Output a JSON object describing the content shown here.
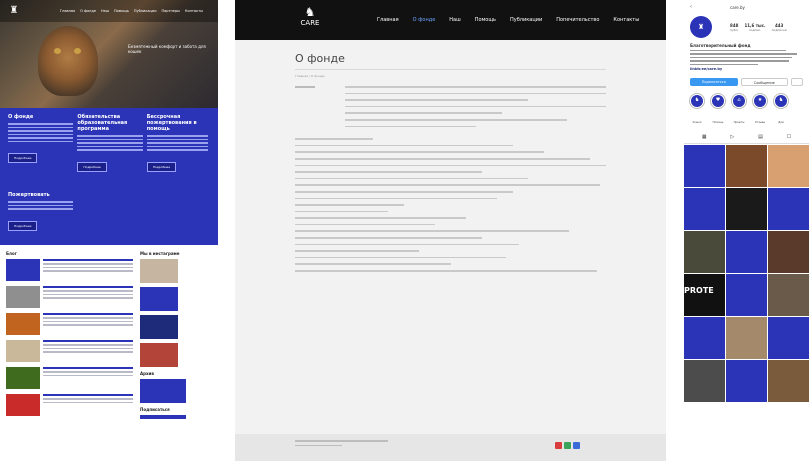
{
  "left": {
    "menu": [
      "Главная",
      "О фонде",
      "Наш",
      "Помощь",
      "Публикации",
      "Партнеры",
      "Контакты"
    ],
    "hero_text": "Безмятежный комфорт и забота для кошек",
    "blue_blocks": [
      {
        "title": "О фонде",
        "button": "Подробнее"
      },
      {
        "title": "Обязательства образовательная программа",
        "button": "Подробнее"
      },
      {
        "title": "Бессрочная пожертвования в помощь",
        "button": "Подробнее"
      },
      {
        "title": "Пожертвовать",
        "button": "Подробнее"
      }
    ],
    "news_heading": "Блог",
    "sidebar_heading": "Мы в инстаграме",
    "sidebar_heading2": "Архив",
    "sidebar_heading3": "Подписаться"
  },
  "mid": {
    "logo": "CARE",
    "menu": [
      "Главная",
      "О фонде",
      "Наш",
      "Помощь",
      "Публикации",
      "Попечительство",
      "Контакты"
    ],
    "active_index": 1,
    "title": "О фонде",
    "breadcrumb": "Главная / О фонде"
  },
  "right": {
    "back_icon": "chevron-left-icon",
    "username": "care.by",
    "stats": [
      {
        "value": "848",
        "label": "публ."
      },
      {
        "value": "11,6 тыс.",
        "label": "подпис."
      },
      {
        "value": "443",
        "label": "подписки"
      }
    ],
    "name": "Благотворительный фонд",
    "link": "linktr.ee/care.by",
    "buttons": [
      "Подписаться",
      "Сообщение"
    ],
    "highlights": [
      "Кошки",
      "Помощь",
      "Приюты",
      "Отзывы",
      "Дом"
    ],
    "grid_label": "PROTE"
  },
  "colors": {
    "brand_blue": "#2b33b6",
    "dark": "#111111",
    "active": "#6fa3ff"
  }
}
